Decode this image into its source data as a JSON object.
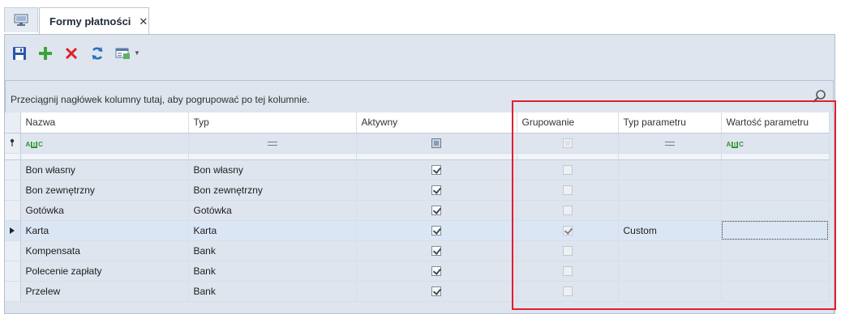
{
  "tabs": {
    "home_icon": "monitor-icon",
    "active_tab_label": "Formy płatności",
    "close_glyph": "✕"
  },
  "toolbar": {
    "buttons": [
      "save-icon",
      "add-icon",
      "delete-icon",
      "refresh-icon",
      "view-options-icon"
    ],
    "dropdown_glyph": "▼"
  },
  "group_panel": {
    "hint": "Przeciągnij nagłówek kolumny tutaj, aby pogrupować po tej kolumnie."
  },
  "grid": {
    "columns": [
      "Nazwa",
      "Typ",
      "Aktywny",
      "Grupowanie",
      "Typ parametru",
      "Wartość parametru"
    ],
    "rows": [
      {
        "nazwa": "Bon własny",
        "typ": "Bon własny",
        "aktywny": true,
        "grupowanie": false,
        "typ_parametru": "",
        "wartosc": ""
      },
      {
        "nazwa": "Bon zewnętrzny",
        "typ": "Bon zewnętrzny",
        "aktywny": true,
        "grupowanie": false,
        "typ_parametru": "",
        "wartosc": ""
      },
      {
        "nazwa": "Gotówka",
        "typ": "Gotówka",
        "aktywny": true,
        "grupowanie": false,
        "typ_parametru": "",
        "wartosc": ""
      },
      {
        "nazwa": "Karta",
        "typ": "Karta",
        "aktywny": true,
        "grupowanie": true,
        "typ_parametru": "Custom",
        "wartosc": ""
      },
      {
        "nazwa": "Kompensata",
        "typ": "Bank",
        "aktywny": true,
        "grupowanie": false,
        "typ_parametru": "",
        "wartosc": ""
      },
      {
        "nazwa": "Polecenie zapłaty",
        "typ": "Bank",
        "aktywny": true,
        "grupowanie": false,
        "typ_parametru": "",
        "wartosc": ""
      },
      {
        "nazwa": "Przelew",
        "typ": "Bank",
        "aktywny": true,
        "grupowanie": false,
        "typ_parametru": "",
        "wartosc": ""
      }
    ],
    "selected_row_index": 3,
    "colors": {
      "selection": "#dbe6f5",
      "highlight_box": "#e0202a"
    }
  }
}
